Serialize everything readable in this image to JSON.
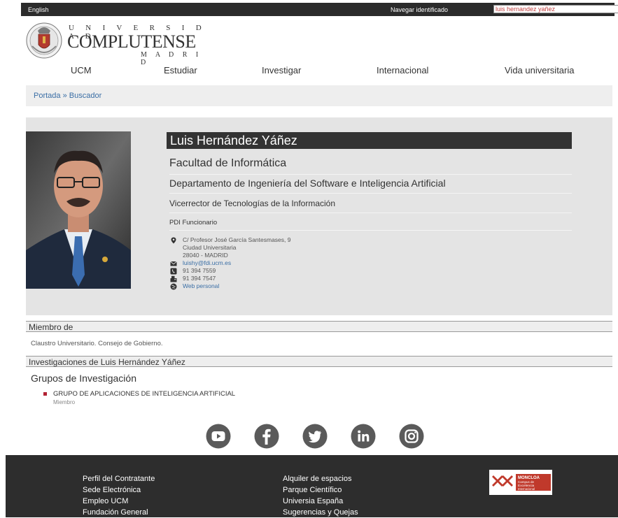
{
  "topbar": {
    "language_link": "English",
    "nav_identified": "Navegar identificado",
    "search_value": "luis hernandez yañez",
    "search_icon": "search-icon"
  },
  "logo": {
    "line1": "U N I V E R S I D A D",
    "line2": "COMPLUTENSE",
    "line3": "M A D R I D"
  },
  "nav": {
    "items": [
      "UCM",
      "Estudiar",
      "Investigar",
      "Internacional",
      "Vida universitaria"
    ]
  },
  "breadcrumb": "Portada » Buscador",
  "profile": {
    "name": "Luis Hernández Yáñez",
    "faculty": "Facultad de Informática",
    "department": "Departamento de Ingeniería del Software e Inteligencia Artificial",
    "position": "Vicerrector de Tecnologías de la Información",
    "category": "PDI Funcionario",
    "address_line1": "C/ Profesor José García Santesmases, 9",
    "address_line2": "Ciudad Universitaria",
    "address_line3": "28040 - MADRID",
    "email": "luishy@fdi.ucm.es",
    "phone": "91 394 7559",
    "fax": "91 394 7547",
    "web": "Web personal"
  },
  "member": {
    "heading": "Miembro de",
    "text": "Claustro Universitario. Consejo de Gobierno."
  },
  "research": {
    "heading": "Investigaciones de Luis Hernández Yáñez",
    "groups_title": "Grupos de Investigación",
    "group_name": "GRUPO DE APLICACIONES DE INTELIGENCIA ARTIFICIAL",
    "group_role": "Miembro"
  },
  "social": [
    "youtube-icon",
    "facebook-icon",
    "twitter-icon",
    "linkedin-icon",
    "instagram-icon"
  ],
  "footer": {
    "col1": [
      "Perfil del Contratante",
      "Sede Electrónica",
      "Empleo UCM",
      "Fundación General"
    ],
    "col2": [
      "Alquiler de espacios",
      "Parque Científico",
      "Universia España",
      "Sugerencias y Quejas"
    ],
    "badge_line1": "MONCLOA",
    "badge_line2": "Campus de",
    "badge_line3": "Excelencia",
    "badge_line4": "Internacional"
  },
  "colors": {
    "topbar": "#2b2b2b",
    "link": "#3a6ea5",
    "footer": "#2d2d2d",
    "accent": "#b22234"
  }
}
